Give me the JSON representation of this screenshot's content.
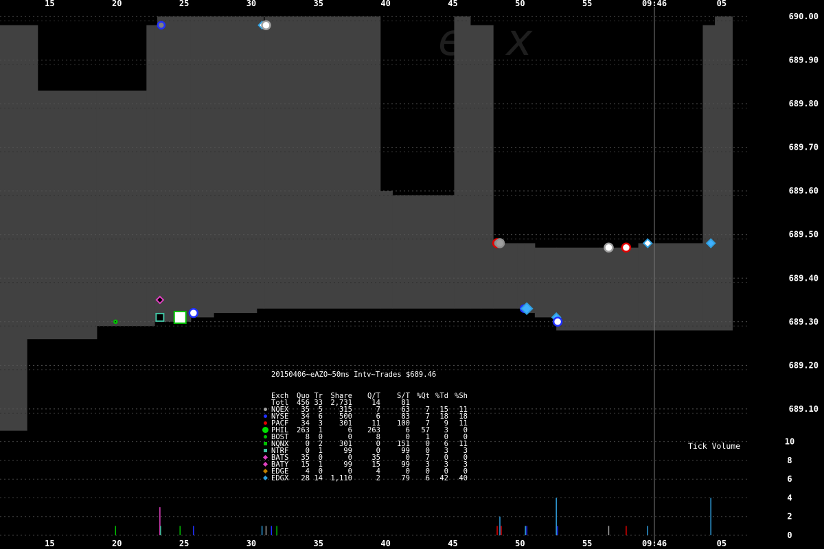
{
  "chart_data": {
    "type": "step-area",
    "title": "20150406~eAZO~50ms Intv~Trades $689.46",
    "x_ticks_top": [
      "15",
      "20",
      "25",
      "30",
      "35",
      "40",
      "45",
      "50",
      "55",
      "09:46",
      "05"
    ],
    "x_ticks_bottom": [
      "15",
      "20",
      "25",
      "30",
      "35",
      "40",
      "45",
      "50",
      "55",
      "09:46",
      "05"
    ],
    "x_tick_pos": [
      15,
      20,
      25,
      30,
      35,
      40,
      45,
      50,
      55,
      60,
      65
    ],
    "xlim": [
      11.3,
      67
    ],
    "price_axis": {
      "ylim": [
        689.04,
        690.0
      ],
      "ticks": [
        "690.00",
        "689.90",
        "689.80",
        "689.70",
        "689.60",
        "689.50",
        "689.40",
        "689.30",
        "689.20",
        "689.10"
      ],
      "tick_values": [
        690.0,
        689.9,
        689.8,
        689.7,
        689.6,
        689.5,
        689.4,
        689.3,
        689.2,
        689.1
      ]
    },
    "volume_axis": {
      "ylim": [
        0,
        10
      ],
      "ticks": [
        "10",
        "8",
        "6",
        "4",
        "2",
        "0"
      ],
      "tick_values": [
        10,
        8,
        6,
        4,
        2,
        0
      ],
      "label": "Tick Volume"
    },
    "nbbo": [
      {
        "x": 11.3,
        "bid": 689.05,
        "ask": 689.98
      },
      {
        "x": 13.3,
        "bid": 689.26,
        "ask": 689.98
      },
      {
        "x": 14.1,
        "bid": 689.26,
        "ask": 689.83
      },
      {
        "x": 18.5,
        "bid": 689.29,
        "ask": 689.83
      },
      {
        "x": 22.2,
        "bid": 689.29,
        "ask": 689.98
      },
      {
        "x": 22.8,
        "bid": 689.3,
        "ask": 689.98
      },
      {
        "x": 23.0,
        "bid": 689.3,
        "ask": 690.0
      },
      {
        "x": 25.5,
        "bid": 689.31,
        "ask": 690.0
      },
      {
        "x": 27.2,
        "bid": 689.32,
        "ask": 690.0
      },
      {
        "x": 30.4,
        "bid": 689.33,
        "ask": 690.0
      },
      {
        "x": 30.9,
        "bid": 689.33,
        "ask": 689.98
      },
      {
        "x": 31.0,
        "bid": 689.33,
        "ask": 690.0
      },
      {
        "x": 39.6,
        "bid": 689.33,
        "ask": 689.6
      },
      {
        "x": 40.5,
        "bid": 689.33,
        "ask": 689.59
      },
      {
        "x": 45.1,
        "bid": 689.33,
        "ask": 690.0
      },
      {
        "x": 46.3,
        "bid": 689.33,
        "ask": 689.98
      },
      {
        "x": 47.1,
        "bid": 689.33,
        "ask": 689.98
      },
      {
        "x": 48.0,
        "bid": 689.33,
        "ask": 689.48
      },
      {
        "x": 49.8,
        "bid": 689.33,
        "ask": 689.48
      },
      {
        "x": 50.3,
        "bid": 689.32,
        "ask": 689.48
      },
      {
        "x": 51.1,
        "bid": 689.31,
        "ask": 689.47
      },
      {
        "x": 52.7,
        "bid": 689.28,
        "ask": 689.47
      },
      {
        "x": 55.9,
        "bid": 689.28,
        "ask": 689.47
      },
      {
        "x": 58.8,
        "bid": 689.28,
        "ask": 689.48
      },
      {
        "x": 63.6,
        "bid": 689.28,
        "ask": 689.98
      },
      {
        "x": 64.5,
        "bid": 689.28,
        "ask": 690.0
      },
      {
        "x": 65.8,
        "bid": 689.28,
        "ask": 690.0
      }
    ],
    "nbbo_colors": {
      "spread": "#414141",
      "background": "#000000",
      "grid": "#666666"
    },
    "trades": [
      {
        "x": 19.9,
        "price": 689.3,
        "exch": "BOST",
        "shape": "circle",
        "fill": "#000000",
        "stroke": "#00c000",
        "size": 4
      },
      {
        "x": 23.2,
        "price": 689.35,
        "exch": "BATS",
        "shape": "diamond",
        "fill": "#000000",
        "stroke": "#e040c0",
        "size": 8
      },
      {
        "x": 23.2,
        "price": 689.31,
        "exch": "NTRF",
        "shape": "square",
        "fill": "#000000",
        "stroke": "#40c0a0",
        "size": 11
      },
      {
        "x": 23.3,
        "price": 689.98,
        "exch": "NYSE",
        "shape": "circle",
        "fill": "#808080",
        "stroke": "#2030ff",
        "size": 10
      },
      {
        "x": 24.7,
        "price": 689.31,
        "exch": "NQNX",
        "shape": "square",
        "fill": "#ffffff",
        "stroke": "#00c000",
        "size": 17
      },
      {
        "x": 25.7,
        "price": 689.32,
        "exch": "NYSE",
        "shape": "circle",
        "fill": "#ffffff",
        "stroke": "#2030ff",
        "size": 12
      },
      {
        "x": 30.8,
        "price": 689.98,
        "exch": "EDGX",
        "shape": "diamond",
        "fill": "#ffffff",
        "stroke": "#30a0e0",
        "size": 8
      },
      {
        "x": 31.1,
        "price": 689.98,
        "exch": "NQEX",
        "shape": "circle",
        "fill": "#ffffff",
        "stroke": "#a0a0a0",
        "size": 12
      },
      {
        "x": 48.3,
        "price": 689.48,
        "exch": "PACF",
        "shape": "circle",
        "fill": "#808080",
        "stroke": "#e00000",
        "size": 12
      },
      {
        "x": 48.5,
        "price": 689.48,
        "exch": "NQEX",
        "shape": "circle",
        "fill": "#a0a0a0",
        "stroke": "#909090",
        "size": 12
      },
      {
        "x": 50.3,
        "price": 689.33,
        "exch": "NYSE",
        "shape": "circle",
        "fill": "#2040ff",
        "stroke": "#2030ff",
        "size": 10
      },
      {
        "x": 50.5,
        "price": 689.33,
        "exch": "EDGX",
        "shape": "diamond",
        "fill": "#40b0ff",
        "stroke": "#30a0e0",
        "size": 14
      },
      {
        "x": 52.7,
        "price": 689.31,
        "exch": "EDGX",
        "shape": "diamond",
        "fill": "#40b0ff",
        "stroke": "#30a0e0",
        "size": 10
      },
      {
        "x": 52.8,
        "price": 689.3,
        "exch": "NYSE",
        "shape": "circle",
        "fill": "#ffffff",
        "stroke": "#2030ff",
        "size": 12
      },
      {
        "x": 56.6,
        "price": 689.47,
        "exch": "NQEX",
        "shape": "circle",
        "fill": "#ffffff",
        "stroke": "#a0a0a0",
        "size": 12
      },
      {
        "x": 57.9,
        "price": 689.47,
        "exch": "PACF",
        "shape": "circle",
        "fill": "#ffffff",
        "stroke": "#e00000",
        "size": 12
      },
      {
        "x": 59.5,
        "price": 689.48,
        "exch": "EDGX",
        "shape": "diamond",
        "fill": "#ffffff",
        "stroke": "#30a0e0",
        "size": 10
      },
      {
        "x": 64.2,
        "price": 689.48,
        "exch": "EDGX",
        "shape": "diamond",
        "fill": "#40b0ff",
        "stroke": "#30a0e0",
        "size": 10
      }
    ],
    "tick_volume": [
      {
        "x": 19.9,
        "v": 1,
        "color": "#00c000"
      },
      {
        "x": 23.2,
        "v": 3,
        "color": "#e040c0"
      },
      {
        "x": 23.25,
        "v": 1,
        "color": "#40c0a0"
      },
      {
        "x": 24.7,
        "v": 1,
        "color": "#00c000"
      },
      {
        "x": 25.7,
        "v": 1,
        "color": "#2030ff"
      },
      {
        "x": 30.8,
        "v": 1,
        "color": "#30a0e0"
      },
      {
        "x": 31.1,
        "v": 1,
        "color": "#a0a0a0"
      },
      {
        "x": 31.5,
        "v": 1,
        "color": "#2030ff"
      },
      {
        "x": 31.9,
        "v": 1,
        "color": "#00c000"
      },
      {
        "x": 48.3,
        "v": 1,
        "color": "#e00000"
      },
      {
        "x": 48.5,
        "v": 2,
        "color": "#30a0e0"
      },
      {
        "x": 48.6,
        "v": 1,
        "color": "#e00000"
      },
      {
        "x": 50.4,
        "v": 1,
        "color": "#30a0e0"
      },
      {
        "x": 50.5,
        "v": 1,
        "color": "#2030ff"
      },
      {
        "x": 52.7,
        "v": 4,
        "color": "#30a0e0"
      },
      {
        "x": 52.8,
        "v": 1,
        "color": "#2030ff"
      },
      {
        "x": 56.6,
        "v": 1,
        "color": "#a0a0a0"
      },
      {
        "x": 57.9,
        "v": 1,
        "color": "#e00000"
      },
      {
        "x": 59.5,
        "v": 1,
        "color": "#30a0e0"
      },
      {
        "x": 64.2,
        "v": 4,
        "color": "#30a0e0"
      }
    ],
    "marker_line_x": 60,
    "stats_table": {
      "header": [
        "Exch",
        "Quo",
        "Tr",
        "Share",
        "Q/T",
        "S/T",
        "%Qt",
        "%Td",
        "%Sh"
      ],
      "rows": [
        {
          "name": "Totl",
          "vals": [
            "456",
            "33",
            "2,731",
            "14",
            "81",
            "",
            "",
            ""
          ],
          "color": "",
          "shape": ""
        },
        {
          "name": "NQEX",
          "vals": [
            "35",
            "5",
            "315",
            "7",
            "63",
            "7",
            "15",
            "11"
          ],
          "color": "#a0a0a0",
          "shape": "circle"
        },
        {
          "name": "NYSE",
          "vals": [
            "34",
            "6",
            "500",
            "6",
            "83",
            "7",
            "18",
            "18"
          ],
          "color": "#2030ff",
          "shape": "circle"
        },
        {
          "name": "PACF",
          "vals": [
            "34",
            "3",
            "301",
            "11",
            "100",
            "7",
            "9",
            "11"
          ],
          "color": "#e00000",
          "shape": "circle"
        },
        {
          "name": "PHIL",
          "vals": [
            "263",
            "1",
            "6",
            "263",
            "6",
            "57",
            "3",
            "0"
          ],
          "color": "#00e000",
          "shape": "bigcircle"
        },
        {
          "name": "BOST",
          "vals": [
            "8",
            "0",
            "0",
            "8",
            "0",
            "1",
            "0",
            "0"
          ],
          "color": "#00c000",
          "shape": "circle"
        },
        {
          "name": "NQNX",
          "vals": [
            "0",
            "2",
            "301",
            "0",
            "151",
            "0",
            "6",
            "11"
          ],
          "color": "#00c000",
          "shape": "sq"
        },
        {
          "name": "NTRF",
          "vals": [
            "0",
            "1",
            "99",
            "0",
            "99",
            "0",
            "3",
            "3"
          ],
          "color": "#40c0a0",
          "shape": "sq"
        },
        {
          "name": "BATS",
          "vals": [
            "35",
            "0",
            "0",
            "35",
            "0",
            "7",
            "0",
            "0"
          ],
          "color": "#e040c0",
          "shape": "dia"
        },
        {
          "name": "BATY",
          "vals": [
            "15",
            "1",
            "99",
            "15",
            "99",
            "3",
            "3",
            "3"
          ],
          "color": "#e040c0",
          "shape": "dia"
        },
        {
          "name": "EDGE",
          "vals": [
            "4",
            "0",
            "0",
            "4",
            "0",
            "0",
            "0",
            "0"
          ],
          "color": "#c08000",
          "shape": "dia"
        },
        {
          "name": "EDGX",
          "vals": [
            "28",
            "14",
            "1,110",
            "2",
            "79",
            "6",
            "42",
            "40"
          ],
          "color": "#30a0e0",
          "shape": "dia"
        }
      ]
    }
  },
  "watermark": "ex",
  "tick_volume_label": "Tick Volume"
}
